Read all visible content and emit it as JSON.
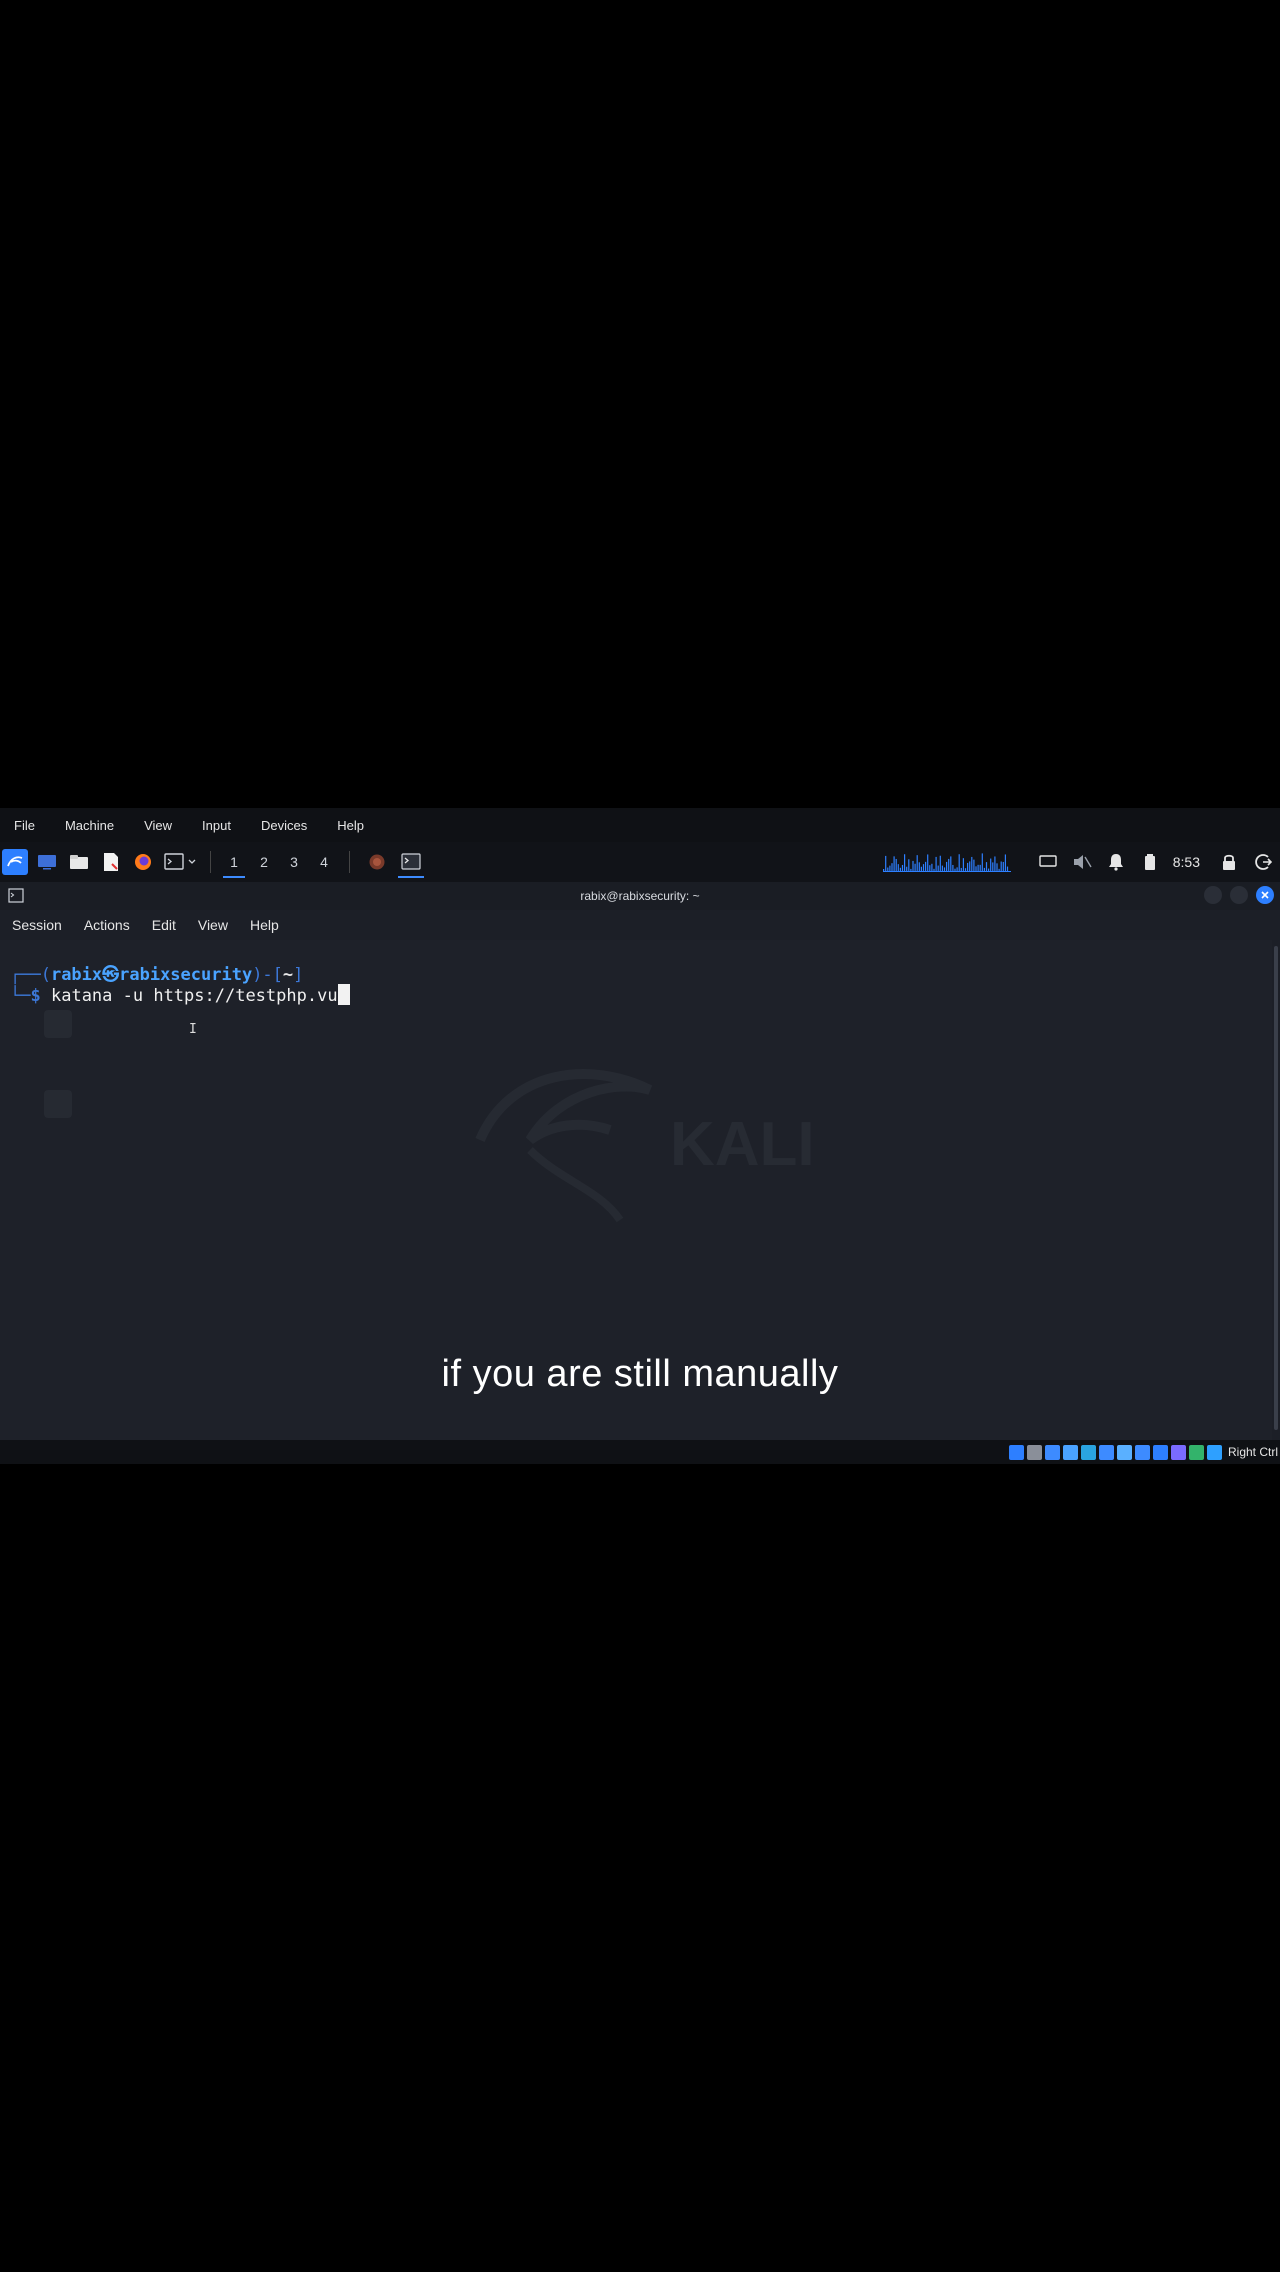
{
  "vbox_menu": [
    "File",
    "Machine",
    "View",
    "Input",
    "Devices",
    "Help"
  ],
  "panel": {
    "workspaces": [
      "1",
      "2",
      "3",
      "4"
    ],
    "active_workspace": "1",
    "clock": "8:53"
  },
  "terminal": {
    "title": "rabix@rabixsecurity: ~",
    "menu": [
      "Session",
      "Actions",
      "Edit",
      "View",
      "Help"
    ],
    "prompt": {
      "top_left": "┌──(",
      "user_host": "rabix㉿rabixsecurity",
      "mid": ")-[",
      "dir": "~",
      "end": "]",
      "bottom_left": "└─",
      "dollar": "$"
    },
    "command": "katana -u https://testphp.vu",
    "watermark_text": "KALI"
  },
  "subtitle": "if you are still manually",
  "statusbar": {
    "host_key": "Right Ctrl",
    "icon_colors": [
      "#2d7fff",
      "#8a8f99",
      "#3d8bff",
      "#4aa3ff",
      "#2aa4e0",
      "#3d8bff",
      "#5ab0ff",
      "#3d8bff",
      "#2d7fff",
      "#7a6bff",
      "#33b36b",
      "#2ea0ff"
    ]
  },
  "colors": {
    "accent": "#2d7fff",
    "terminal_bg": "#1e2129"
  }
}
